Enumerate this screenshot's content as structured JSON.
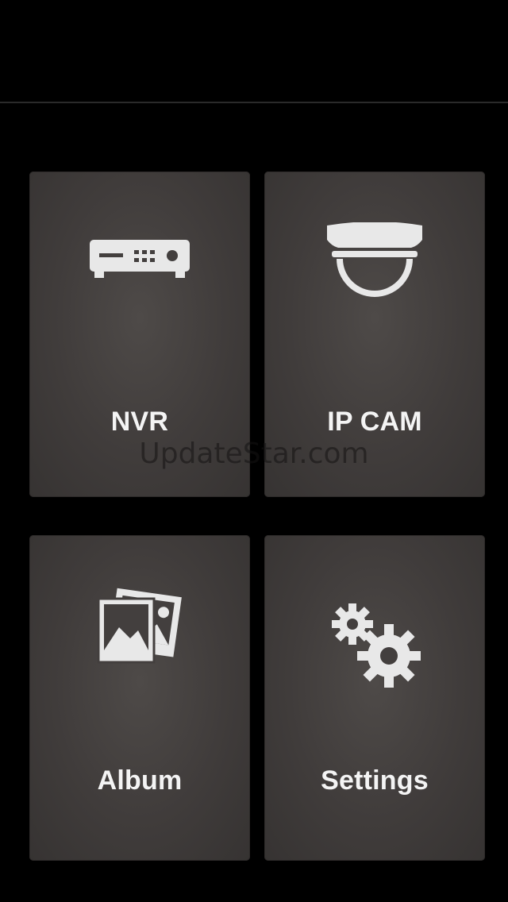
{
  "menu": {
    "tiles": [
      {
        "label": "NVR",
        "icon": "nvr-device-icon"
      },
      {
        "label": "IP CAM",
        "icon": "dome-camera-icon"
      },
      {
        "label": "Album",
        "icon": "photo-album-icon"
      },
      {
        "label": "Settings",
        "icon": "gears-icon"
      }
    ]
  },
  "watermark": "UpdateStar.com",
  "colors": {
    "background": "#000000",
    "tile": "#433f3e",
    "text": "#f4f4f4",
    "icon": "#e8e8e8"
  }
}
